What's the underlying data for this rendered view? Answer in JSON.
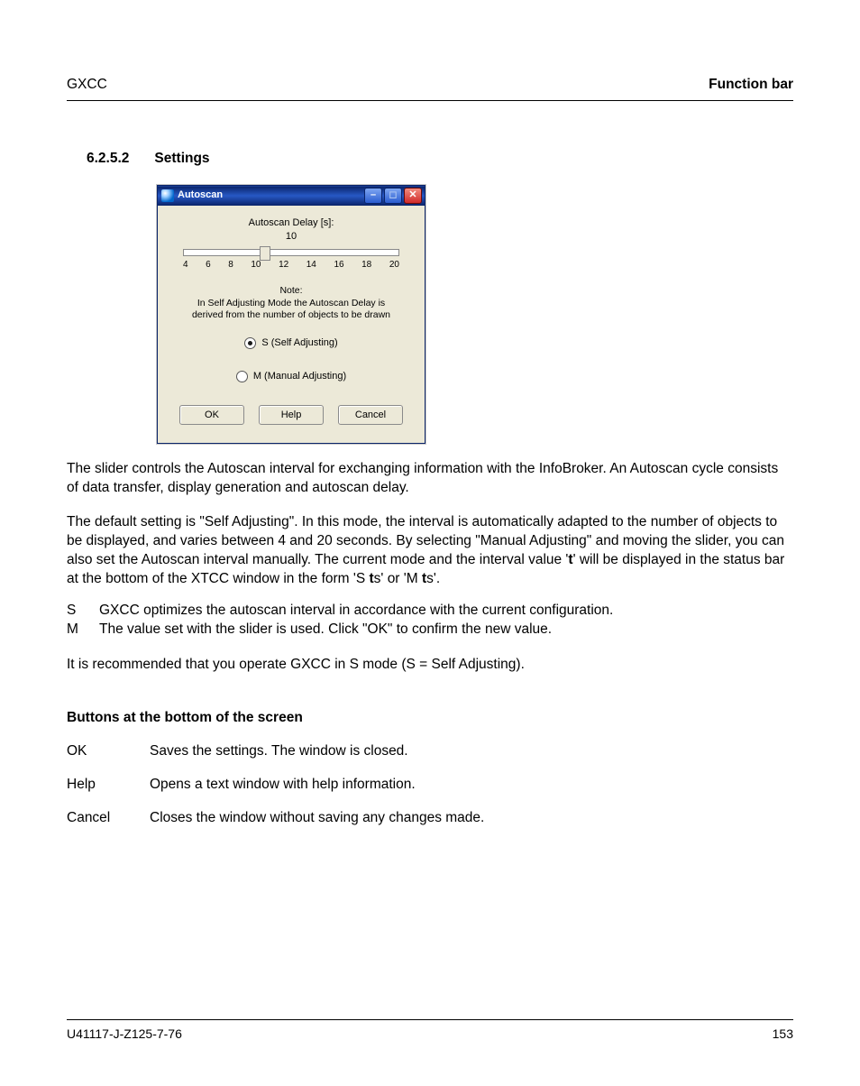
{
  "header": {
    "left": "GXCC",
    "right": "Function bar"
  },
  "section": {
    "number": "6.2.5.2",
    "title": "Settings"
  },
  "dialog": {
    "title": "Autoscan",
    "slider_label": "Autoscan Delay [s]:",
    "slider_value": "10",
    "ticks": [
      "4",
      "6",
      "8",
      "10",
      "12",
      "14",
      "16",
      "18",
      "20"
    ],
    "note_title": "Note:",
    "note_line1": "In Self Adjusting Mode the Autoscan Delay is",
    "note_line2": "derived from the number of objects to be drawn",
    "radio_s": "S (Self Adjusting)",
    "radio_m": "M (Manual Adjusting)",
    "buttons": {
      "ok": "OK",
      "help": "Help",
      "cancel": "Cancel"
    }
  },
  "para1": "The slider controls the Autoscan interval for exchanging information with the InfoBroker. An Autoscan cycle consists of data transfer, display generation and autoscan delay.",
  "para2_a": "The default setting is \"Self Adjusting\". In this mode, the interval is automatically adapted to the number of objects to be displayed, and varies between 4 and 20 seconds. By selecting \"Manual Adjusting\" and moving the slider, you can also set the Autoscan interval manually. The current mode and the interval value '",
  "para2_b": "t",
  "para2_c": "' will be displayed in the status bar at the bottom of the XTCC window in the form 'S ",
  "para2_d": "t",
  "para2_e": "s' or 'M ",
  "para2_f": "t",
  "para2_g": "s'.",
  "defs": {
    "s_key": "S",
    "s_val": "GXCC optimizes the autoscan interval in accordance with the current configuration.",
    "m_key": "M",
    "m_val": "The value set with the slider is used. Click \"OK\" to confirm the new value."
  },
  "para3": "It is recommended that you operate GXCC in S mode (S = Self Adjusting).",
  "subhead": "Buttons at the bottom of the screen",
  "btable": {
    "ok_key": "OK",
    "ok_val": "Saves the settings. The window is closed.",
    "help_key": "Help",
    "help_val": "Opens a text window with help information.",
    "cancel_key": "Cancel",
    "cancel_val": "Closes the window without saving any changes made."
  },
  "footer": {
    "left": "U41117-J-Z125-7-76",
    "right": "153"
  }
}
